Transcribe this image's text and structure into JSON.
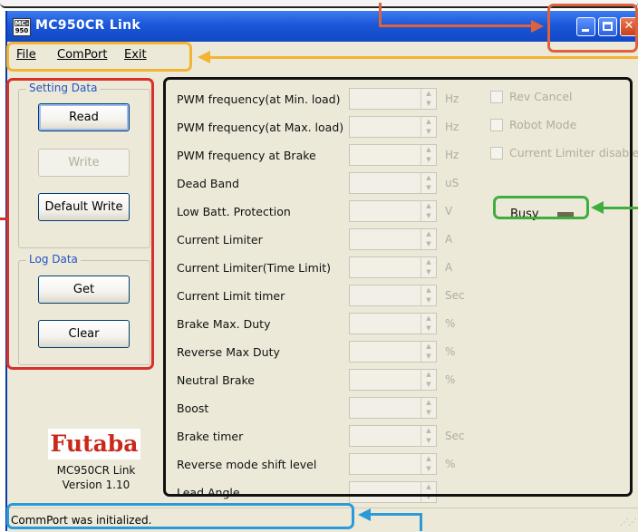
{
  "window": {
    "title": "MC950CR Link",
    "icon_top": "MC-",
    "icon_bottom": "950"
  },
  "menu": {
    "file": "File",
    "comport": "ComPort",
    "exit": "Exit"
  },
  "setting_data": {
    "legend": "Setting Data",
    "read": "Read",
    "write": "Write",
    "default_write": "Default Write"
  },
  "log_data": {
    "legend": "Log Data",
    "get": "Get",
    "clear": "Clear"
  },
  "brand": {
    "logo": "Futaba",
    "product": "MC950CR Link",
    "version": "Version 1.10"
  },
  "params": [
    {
      "label": "PWM frequency(at Min. load)",
      "unit": "Hz"
    },
    {
      "label": "PWM frequency(at Max. load)",
      "unit": "Hz"
    },
    {
      "label": "PWM frequency at Brake",
      "unit": "Hz"
    },
    {
      "label": "Dead Band",
      "unit": "uS"
    },
    {
      "label": "Low Batt. Protection",
      "unit": "V"
    },
    {
      "label": "Current Limiter",
      "unit": "A"
    },
    {
      "label": "Current Limiter(Time Limit)",
      "unit": "A"
    },
    {
      "label": "Current Limit timer",
      "unit": "Sec"
    },
    {
      "label": "Brake Max. Duty",
      "unit": "%"
    },
    {
      "label": "Reverse Max Duty",
      "unit": "%"
    },
    {
      "label": "Neutral Brake",
      "unit": "%"
    },
    {
      "label": "Boost",
      "unit": ""
    },
    {
      "label": "Brake timer",
      "unit": "Sec"
    },
    {
      "label": "Reverse mode shift level",
      "unit": "%"
    },
    {
      "label": "Lead Angle",
      "unit": ""
    }
  ],
  "options": {
    "rev_cancel": "Rev Cancel",
    "robot_mode": "Robot Mode",
    "current_limiter_disable": "Current Limiter disable"
  },
  "busy": {
    "label": "Busy"
  },
  "status": {
    "text": "CommPort was initialized."
  },
  "annotation_colors": {
    "titlebar_buttons": "#e0623a",
    "menu": "#f3b531",
    "left_panel": "#d9302c",
    "busy": "#3fae3f",
    "param_panel": "#111111",
    "status": "#2b9bd8"
  }
}
